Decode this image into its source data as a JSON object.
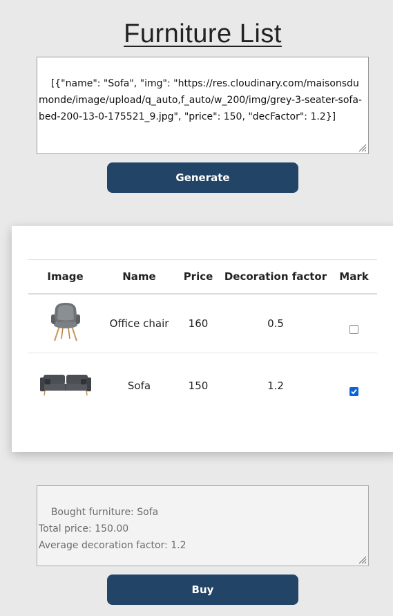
{
  "header": {
    "title": "Furniture List"
  },
  "input": {
    "value": "[{\"name\": \"Sofa\", \"img\": \"https://res.cloudinary.com/maisonsdumonde/image/upload/q_auto,f_auto/w_200/img/grey-3-seater-sofa-bed-200-13-0-175521_9.jpg\", \"price\": 150, \"decFactor\": 1.2}]"
  },
  "buttons": {
    "generate_label": "Generate",
    "buy_label": "Buy"
  },
  "table": {
    "headers": {
      "image": "Image",
      "name": "Name",
      "price": "Price",
      "decoration": "Decoration factor",
      "mark": "Mark"
    },
    "rows": [
      {
        "image_icon": "office-chair-image",
        "name": "Office chair",
        "price": "160",
        "decFactor": "0.5",
        "marked": false
      },
      {
        "image_icon": "sofa-image",
        "name": "Sofa",
        "price": "150",
        "decFactor": "1.2",
        "marked": true
      }
    ]
  },
  "output": {
    "value": "Bought furniture: Sofa\nTotal price: 150.00\nAverage decoration factor: 1.2"
  },
  "colors": {
    "button_bg": "#224466",
    "checkbox_checked": "#0b62d6",
    "page_bg": "#e9e9e9"
  }
}
